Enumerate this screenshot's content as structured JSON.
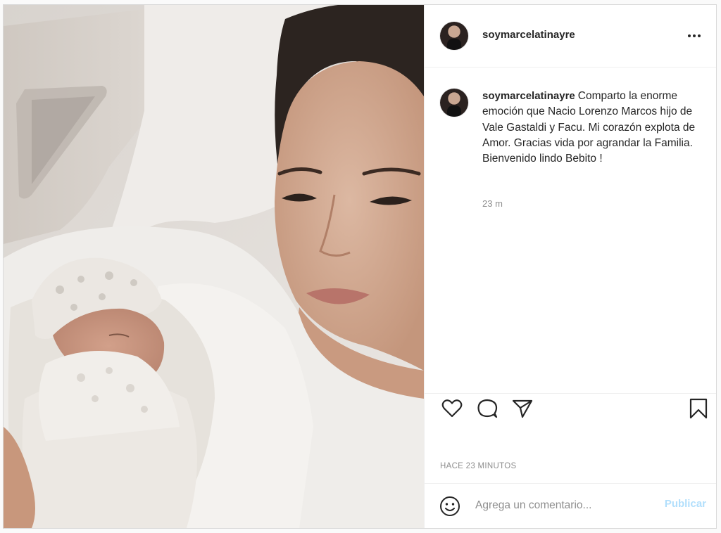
{
  "post": {
    "username": "soymarcelatinayre",
    "caption": "Comparto la enorme emoción que Nacio Lorenzo Marcos hijo de Vale Gastaldi y Facu. Mi corazón explota de Amor. Gracias vida por agrandar la Familia. Bienvenido lindo Bebito !",
    "caption_age": "23 m",
    "timestamp": "Hace 23 minutos",
    "comment_placeholder": "Agrega un comentario...",
    "publish_label": "Publicar"
  },
  "icons": {
    "more": "more-horizontal-icon",
    "like": "heart-outline-icon",
    "comment": "comment-bubble-icon",
    "share": "paper-plane-icon",
    "save": "bookmark-outline-icon",
    "emoji": "smiley-face-icon"
  },
  "colors": {
    "text": "#262626",
    "muted": "#8e8e8e",
    "border": "#dbdbdb",
    "publish_disabled": "#b2dffc"
  }
}
